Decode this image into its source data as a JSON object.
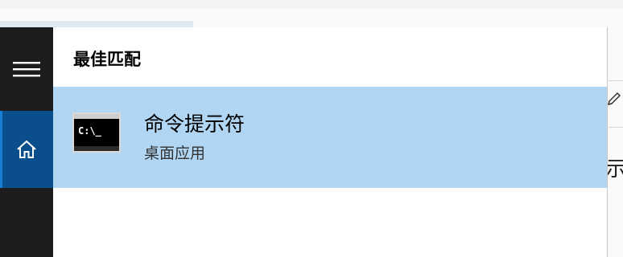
{
  "rail": {
    "menu_icon": "hamburger-menu-icon",
    "home_icon": "home-icon"
  },
  "results": {
    "section_title": "最佳匹配",
    "best_match": {
      "name": "命令提示符",
      "type": "桌面应用",
      "icon": "command-prompt-icon",
      "icon_text": "C:\\_"
    }
  },
  "background": {
    "edge_text": "示",
    "pencil_icon": "pencil-icon"
  },
  "colors": {
    "rail_bg": "#1c1c1c",
    "home_selected": "#0a4f8c",
    "highlight": "#b1d6f3"
  }
}
